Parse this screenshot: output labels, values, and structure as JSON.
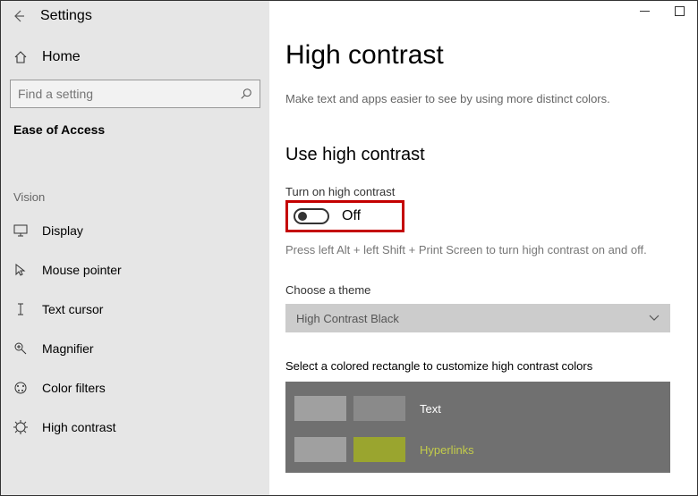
{
  "app_title": "Settings",
  "home_label": "Home",
  "search": {
    "placeholder": "Find a setting"
  },
  "group_title": "Ease of Access",
  "section_label": "Vision",
  "nav": {
    "display": "Display",
    "mouse": "Mouse pointer",
    "textcursor": "Text cursor",
    "magnifier": "Magnifier",
    "colorfilters": "Color filters",
    "highcontrast": "High contrast"
  },
  "page": {
    "title": "High contrast",
    "subtitle": "Make text and apps easier to see by using more distinct colors.",
    "use_heading": "Use high contrast",
    "turn_on_label": "Turn on high contrast",
    "toggle_state": "Off",
    "hint": "Press left Alt + left Shift + Print Screen to turn high contrast on and off.",
    "choose_theme_label": "Choose a theme",
    "theme_selected": "High Contrast Black",
    "customize_label": "Select a colored rectangle to customize high contrast colors",
    "swatches": {
      "text": "Text",
      "hyperlinks": "Hyperlinks"
    }
  }
}
